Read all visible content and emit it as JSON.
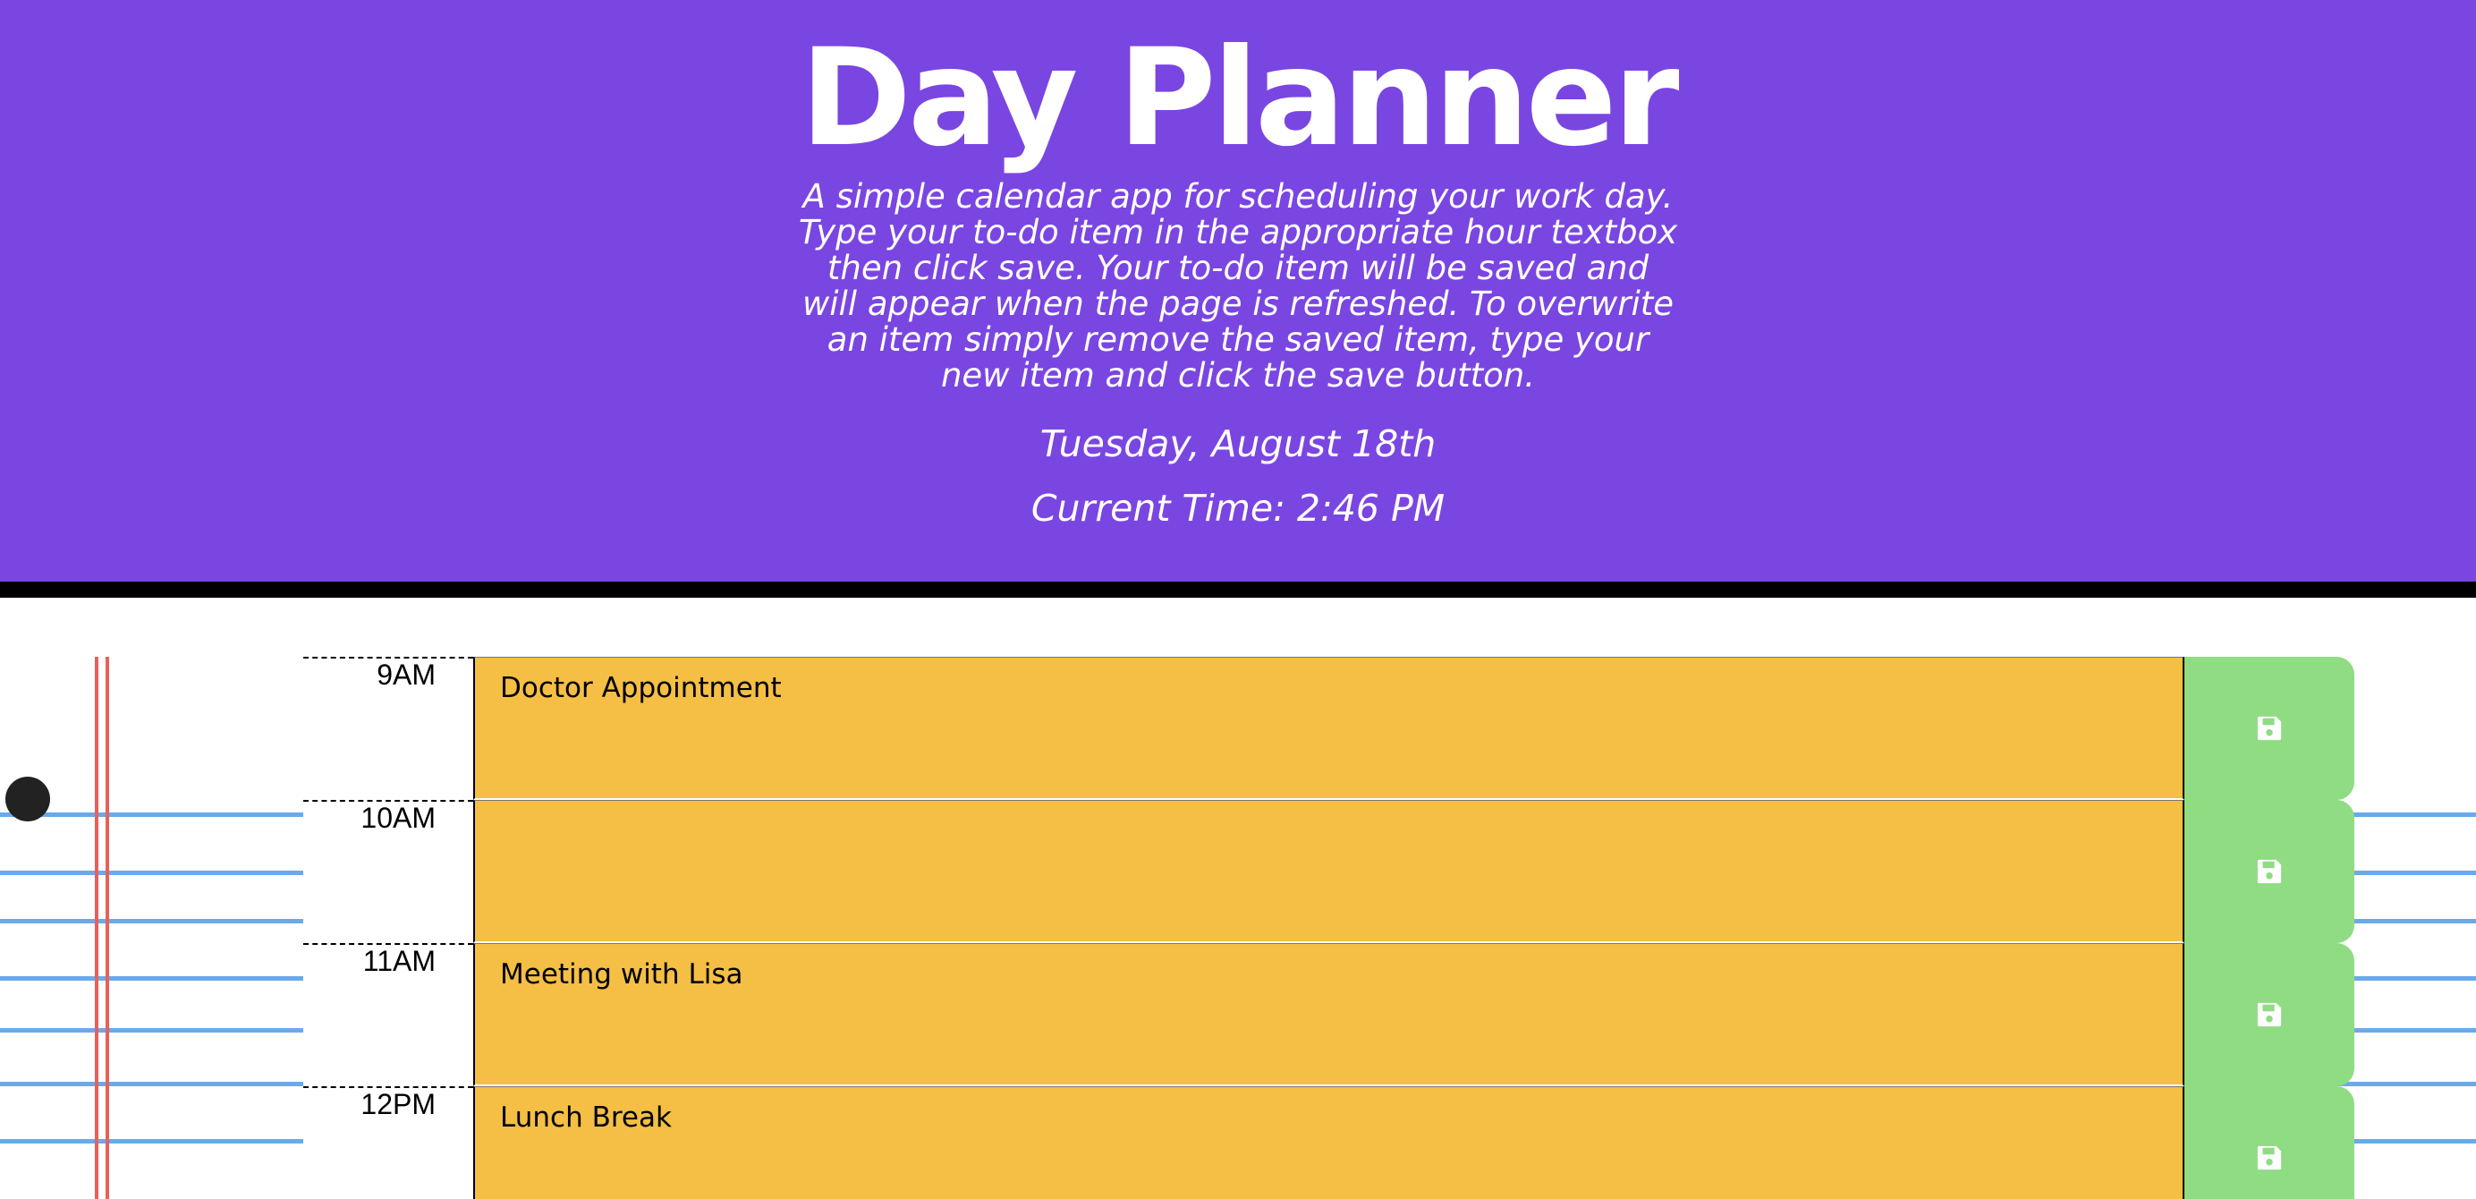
{
  "header": {
    "title": "Day Planner",
    "description_lines": [
      "A simple calendar app for scheduling your work day.",
      "Type your to-do item in the appropriate hour textbox",
      "then click save. Your to-do item will be saved and",
      "will appear when the page is refreshed. To overwrite",
      "an item simply remove the saved item, type your",
      "new item and click the save button."
    ],
    "date": "Tuesday, August 18th",
    "current_time": "Current Time: 2:46 PM"
  },
  "rows": [
    {
      "hour": "9AM",
      "task": "Doctor Appointment",
      "save_icon": "floppy-disk-icon"
    },
    {
      "hour": "10AM",
      "task": "",
      "save_icon": "floppy-disk-icon"
    },
    {
      "hour": "11AM",
      "task": "Meeting with Lisa",
      "save_icon": "floppy-disk-icon"
    },
    {
      "hour": "12PM",
      "task": "Lunch Break",
      "save_icon": "floppy-disk-icon"
    }
  ],
  "colors": {
    "header_bg": "#7a46e2",
    "task_bg": "#f4bf44",
    "save_bg": "#8fdc83",
    "notebook_line": "#6aaae8",
    "margin_line": "#e8605c"
  }
}
